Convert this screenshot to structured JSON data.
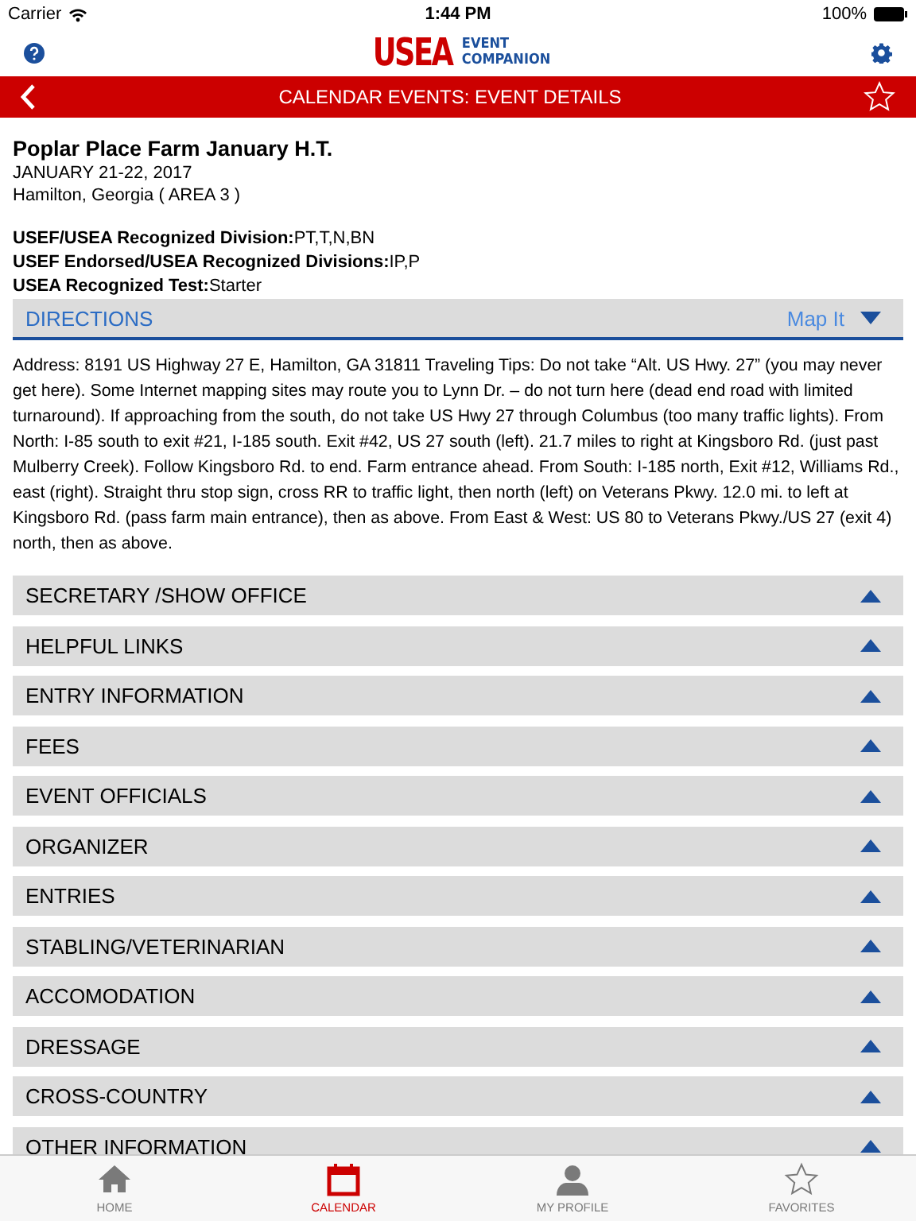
{
  "status_bar": {
    "carrier": "Carrier",
    "time": "1:44 PM",
    "battery": "100%"
  },
  "header": {
    "logo_main": "USEA",
    "logo_top": "EVENT",
    "logo_bottom": "COMPANION"
  },
  "title_bar": {
    "title": "CALENDAR EVENTS: EVENT DETAILS",
    "favorite": false
  },
  "event": {
    "name": "Poplar Place Farm January H.T.",
    "dates": "JANUARY 21-22, 2017",
    "location": "Hamilton, Georgia ( AREA 3 )",
    "facts": [
      {
        "label": "USEF/USEA Recognized Division:",
        "value": "PT,T,N,BN"
      },
      {
        "label": "USEF Endorsed/USEA Recognized Divisions:",
        "value": "IP,P"
      },
      {
        "label": "USEA Recognized Test:",
        "value": "Starter"
      }
    ]
  },
  "directions": {
    "title": "DIRECTIONS",
    "map_link": "Map It",
    "expanded": true,
    "text": "Address: 8191 US Highway 27 E, Hamilton, GA 31811 Traveling Tips: Do not take “Alt. US Hwy. 27” (you may never get here). Some Internet mapping sites may route you to Lynn Dr. – do not turn here (dead end road with limited turnaround). If approaching from the south, do not take US Hwy 27 through Columbus (too many traffic lights). From North: I-85 south to exit #21, I-185 south. Exit #42, US 27 south (left). 21.7 miles to right at Kingsboro Rd. (just past Mulberry Creek). Follow Kingsboro Rd. to end. Farm entrance ahead. From South: I-185 north, Exit #12, Williams Rd., east (right). Straight thru stop sign, cross RR to traffic light, then north (left) on Veterans Pkwy. 12.0 mi. to left at Kingsboro Rd. (pass farm main entrance), then as above. From East & West: US 80 to Veterans Pkwy./US 27 (exit 4) north, then as above."
  },
  "sections": [
    {
      "title": "SECRETARY /SHOW OFFICE",
      "expanded": false
    },
    {
      "title": "HELPFUL LINKS",
      "expanded": false
    },
    {
      "title": "ENTRY INFORMATION",
      "expanded": false
    },
    {
      "title": "FEES",
      "expanded": false
    },
    {
      "title": "EVENT OFFICIALS",
      "expanded": false
    },
    {
      "title": "ORGANIZER",
      "expanded": false
    },
    {
      "title": "ENTRIES",
      "expanded": false
    },
    {
      "title": "STABLING/VETERINARIAN",
      "expanded": false
    },
    {
      "title": "ACCOMODATION",
      "expanded": false
    },
    {
      "title": "DRESSAGE",
      "expanded": false
    },
    {
      "title": "CROSS-COUNTRY",
      "expanded": false
    },
    {
      "title": "OTHER INFORMATION",
      "expanded": false
    }
  ],
  "tab_bar": [
    {
      "kind": "home",
      "label": "HOME",
      "selected": false
    },
    {
      "kind": "calendar",
      "label": "CALENDAR",
      "selected": true
    },
    {
      "kind": "profile",
      "label": "MY PROFILE",
      "selected": false
    },
    {
      "kind": "favorites",
      "label": "FAVORITES",
      "selected": false
    }
  ]
}
